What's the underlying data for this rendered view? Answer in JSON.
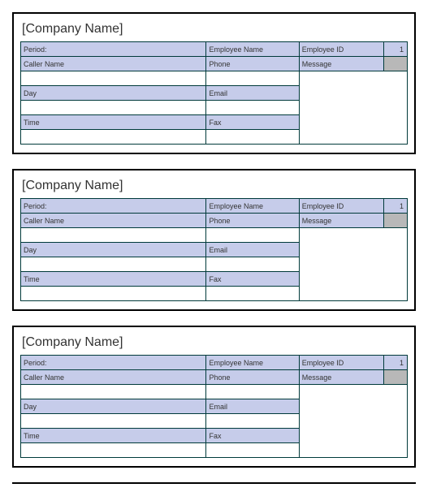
{
  "cards": [
    {
      "company": "[Company Name]",
      "period_label": "Period:",
      "employee_name_label": "Employee Name",
      "employee_id_label": "Employee ID",
      "employee_id_value": "1",
      "caller_label": "Caller Name",
      "phone_label": "Phone",
      "message_label": "Message",
      "day_label": "Day",
      "email_label": "Email",
      "time_label": "Time",
      "fax_label": "Fax"
    },
    {
      "company": "[Company Name]",
      "period_label": "Period:",
      "employee_name_label": "Employee Name",
      "employee_id_label": "Employee ID",
      "employee_id_value": "1",
      "caller_label": "Caller Name",
      "phone_label": "Phone",
      "message_label": "Message",
      "day_label": "Day",
      "email_label": "Email",
      "time_label": "Time",
      "fax_label": "Fax"
    },
    {
      "company": "[Company Name]",
      "period_label": "Period:",
      "employee_name_label": "Employee Name",
      "employee_id_label": "Employee ID",
      "employee_id_value": "1",
      "caller_label": "Caller Name",
      "phone_label": "Phone",
      "message_label": "Message",
      "day_label": "Day",
      "email_label": "Email",
      "time_label": "Time",
      "fax_label": "Fax"
    }
  ]
}
